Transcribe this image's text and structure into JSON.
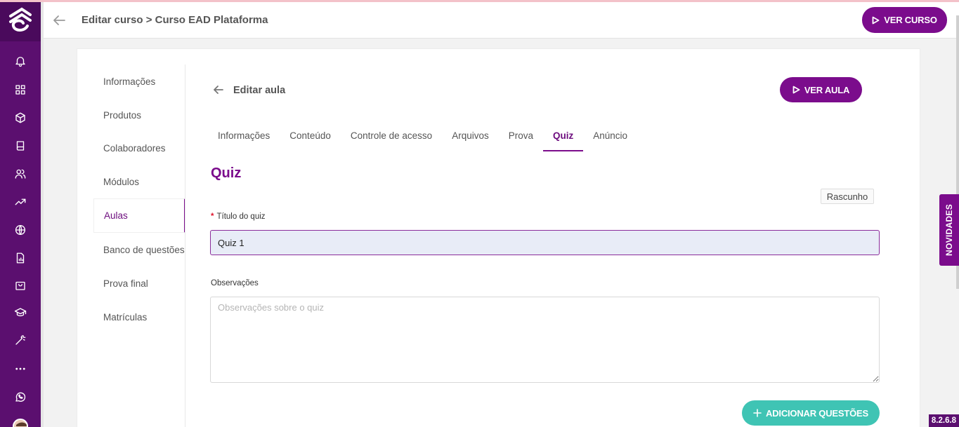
{
  "header": {
    "title": "Editar curso > Curso EAD Plataforma",
    "view_course_label": "VER CURSO"
  },
  "sidebar_icons": [
    "bell-icon",
    "grid-icon",
    "box-icon",
    "book-icon",
    "users-icon",
    "trending-icon",
    "globe-icon",
    "report-icon",
    "bag-icon",
    "graduation-icon",
    "magic-wand-icon",
    "more-icon",
    "whatsapp-icon"
  ],
  "course_nav": {
    "items": [
      {
        "label": "Informações"
      },
      {
        "label": "Produtos"
      },
      {
        "label": "Colaboradores"
      },
      {
        "label": "Módulos"
      },
      {
        "label": "Aulas"
      },
      {
        "label": "Banco de questões"
      },
      {
        "label": "Prova final"
      },
      {
        "label": "Matrículas"
      }
    ],
    "active": "Aulas"
  },
  "lesson": {
    "title": "Editar aula",
    "view_lesson_label": "VER AULA"
  },
  "tabs": [
    {
      "label": "Informações"
    },
    {
      "label": "Conteúdo"
    },
    {
      "label": "Controle de acesso"
    },
    {
      "label": "Arquivos"
    },
    {
      "label": "Prova"
    },
    {
      "label": "Quiz"
    },
    {
      "label": "Anúncio"
    }
  ],
  "active_tab": "Quiz",
  "quiz": {
    "section_title": "Quiz",
    "status": "Rascunho",
    "title_label": "Título do quiz",
    "title_required_mark": "*",
    "title_value": "Quiz 1",
    "notes_label": "Observações",
    "notes_placeholder": "Observações sobre o quiz",
    "notes_value": "",
    "add_questions_label": "ADICIONAR QUESTÕES"
  },
  "news_tab": "NOVIDADES",
  "version": "8.2.6.8",
  "colors": {
    "brand_purple": "#7b0c8c",
    "sidebar_purple": "#5b0f6f",
    "teal": "#3fc4b4"
  }
}
